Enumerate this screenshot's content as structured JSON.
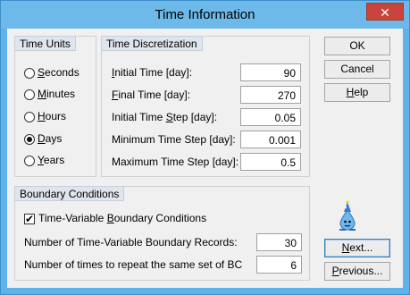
{
  "window": {
    "title": "Time Information",
    "close_glyph": "✕"
  },
  "time_units": {
    "title": "Time Units",
    "options": [
      {
        "label": "Seconds",
        "mnemonic": "S",
        "rest": "econds",
        "selected": false
      },
      {
        "label": "Minutes",
        "mnemonic": "M",
        "rest": "inutes",
        "selected": false
      },
      {
        "label": "Hours",
        "mnemonic": "H",
        "rest": "ours",
        "selected": false
      },
      {
        "label": "Days",
        "mnemonic": "D",
        "rest": "ays",
        "selected": true
      },
      {
        "label": "Years",
        "mnemonic": "Y",
        "rest": "ears",
        "selected": false
      }
    ]
  },
  "discretization": {
    "title": "Time Discretization",
    "fields": [
      {
        "mnemonic": "I",
        "rest": "nitial Time [day]:",
        "value": "90"
      },
      {
        "mnemonic": "F",
        "rest": "inal Time [day]:",
        "value": "270"
      },
      {
        "pre": "Initial Time ",
        "mnemonic": "S",
        "rest": "tep [day]:",
        "value": "0.05"
      },
      {
        "pre": "Minimum Time Step [day]:",
        "mnemonic": "",
        "rest": "",
        "value": "0.001"
      },
      {
        "pre": "Maximum Time Step [day]:",
        "mnemonic": "",
        "rest": "",
        "value": "0.5"
      }
    ]
  },
  "boundary": {
    "title": "Boundary Conditions",
    "checkbox": {
      "pre": "Time-Variable ",
      "mnemonic": "B",
      "rest": "oundary Conditions",
      "checked": true
    },
    "records_label": "Number of Time-Variable Boundary Records:",
    "records_value": "30",
    "repeat_label": "Number of times to repeat the same set of BC",
    "repeat_value": "6"
  },
  "buttons": {
    "ok": "OK",
    "cancel": "Cancel",
    "help_mn": "H",
    "help_rest": "elp",
    "next_mn": "N",
    "next_rest": "ext...",
    "previous_mn": "P",
    "previous_rest": "revious..."
  },
  "colors": {
    "title_bar": "#6cb9ea",
    "close_button": "#c7453a",
    "dialog_bg": "#f0f0f0"
  },
  "icons": {
    "mascot": "droplet-wizard-icon"
  }
}
